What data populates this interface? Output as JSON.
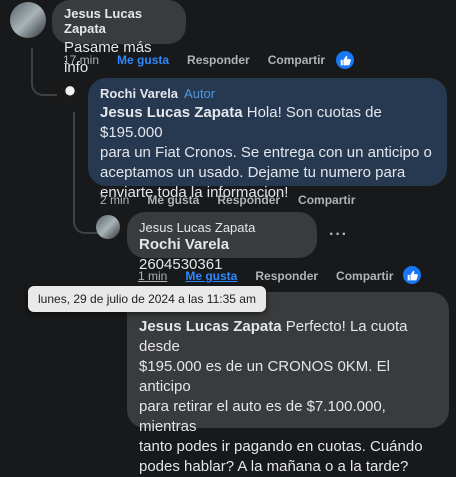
{
  "comments": [
    {
      "author": "Jesus Lucas Zapata",
      "text": "Pasame más info",
      "time": "17 min",
      "like_label": "Me gusta",
      "reply_label": "Responder",
      "share_label": "Compartir"
    },
    {
      "author": "Rochi Varela",
      "author_badge": "Autor",
      "mention": "Jesus Lucas Zapata",
      "text_lines": [
        " Hola! Son cuotas de $195.000",
        "para un Fiat Cronos. Se entrega con un anticipo o",
        "aceptamos un usado. Dejame tu numero para",
        "enviarte toda la informacion!"
      ],
      "time": "2 min",
      "like_label": "Me gusta",
      "reply_label": "Responder",
      "share_label": "Compartir"
    },
    {
      "author": "Jesus Lucas Zapata",
      "mention": "Rochi Varela",
      "text": " 2604530361",
      "more_label": "···",
      "time": "1 min",
      "like_label": "Me gusta",
      "reply_label": "Responder",
      "share_label": "Compartir"
    },
    {
      "author": "Rochi Varela",
      "author_badge": "Autor",
      "mention": "Jesus Lucas Zapata",
      "text_lines": [
        " Perfecto! La cuota desde",
        "$195.000 es de un CRONOS 0KM. El anticipo",
        "para retirar el auto es de $7.100.000, mientras",
        "tanto podes ir pagando en cuotas. Cuándo",
        "podes hablar? A la mañana o a la tarde?"
      ]
    }
  ],
  "tooltip": "lunes, 29 de julio de 2024 a las 11:35 am",
  "reaction_icon": "thumbs-up-icon",
  "colors": {
    "like": "#2d88ff",
    "author_badge": "#4e97e0",
    "reaction_bg": "#1877f2"
  }
}
